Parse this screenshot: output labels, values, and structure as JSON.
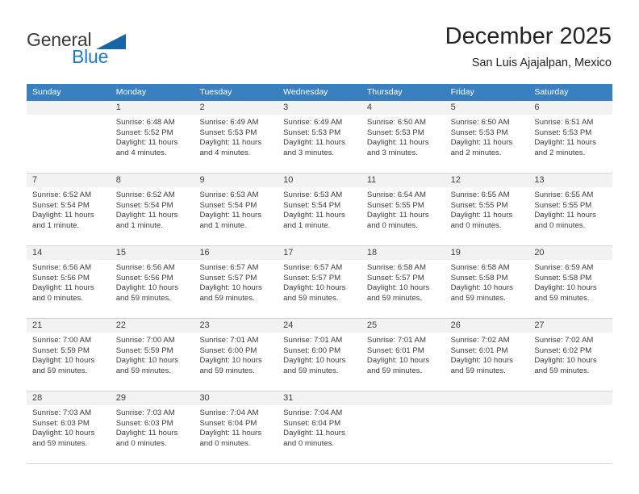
{
  "brand": {
    "name_part1": "General",
    "name_part2": "Blue",
    "accent_color": "#1f7bc1",
    "flag_color": "#1665a8"
  },
  "header": {
    "title": "December 2025",
    "subtitle": "San Luis Ajajalpan, Mexico"
  },
  "calendar": {
    "header_bg": "#3a80c1",
    "weekdays": [
      "Sunday",
      "Monday",
      "Tuesday",
      "Wednesday",
      "Thursday",
      "Friday",
      "Saturday"
    ],
    "weeks": [
      [
        {
          "day": "",
          "lines": []
        },
        {
          "day": "1",
          "lines": [
            "Sunrise: 6:48 AM",
            "Sunset: 5:52 PM",
            "Daylight: 11 hours",
            "and 4 minutes."
          ]
        },
        {
          "day": "2",
          "lines": [
            "Sunrise: 6:49 AM",
            "Sunset: 5:53 PM",
            "Daylight: 11 hours",
            "and 4 minutes."
          ]
        },
        {
          "day": "3",
          "lines": [
            "Sunrise: 6:49 AM",
            "Sunset: 5:53 PM",
            "Daylight: 11 hours",
            "and 3 minutes."
          ]
        },
        {
          "day": "4",
          "lines": [
            "Sunrise: 6:50 AM",
            "Sunset: 5:53 PM",
            "Daylight: 11 hours",
            "and 3 minutes."
          ]
        },
        {
          "day": "5",
          "lines": [
            "Sunrise: 6:50 AM",
            "Sunset: 5:53 PM",
            "Daylight: 11 hours",
            "and 2 minutes."
          ]
        },
        {
          "day": "6",
          "lines": [
            "Sunrise: 6:51 AM",
            "Sunset: 5:53 PM",
            "Daylight: 11 hours",
            "and 2 minutes."
          ]
        }
      ],
      [
        {
          "day": "7",
          "lines": [
            "Sunrise: 6:52 AM",
            "Sunset: 5:54 PM",
            "Daylight: 11 hours",
            "and 1 minute."
          ]
        },
        {
          "day": "8",
          "lines": [
            "Sunrise: 6:52 AM",
            "Sunset: 5:54 PM",
            "Daylight: 11 hours",
            "and 1 minute."
          ]
        },
        {
          "day": "9",
          "lines": [
            "Sunrise: 6:53 AM",
            "Sunset: 5:54 PM",
            "Daylight: 11 hours",
            "and 1 minute."
          ]
        },
        {
          "day": "10",
          "lines": [
            "Sunrise: 6:53 AM",
            "Sunset: 5:54 PM",
            "Daylight: 11 hours",
            "and 1 minute."
          ]
        },
        {
          "day": "11",
          "lines": [
            "Sunrise: 6:54 AM",
            "Sunset: 5:55 PM",
            "Daylight: 11 hours",
            "and 0 minutes."
          ]
        },
        {
          "day": "12",
          "lines": [
            "Sunrise: 6:55 AM",
            "Sunset: 5:55 PM",
            "Daylight: 11 hours",
            "and 0 minutes."
          ]
        },
        {
          "day": "13",
          "lines": [
            "Sunrise: 6:55 AM",
            "Sunset: 5:55 PM",
            "Daylight: 11 hours",
            "and 0 minutes."
          ]
        }
      ],
      [
        {
          "day": "14",
          "lines": [
            "Sunrise: 6:56 AM",
            "Sunset: 5:56 PM",
            "Daylight: 11 hours",
            "and 0 minutes."
          ]
        },
        {
          "day": "15",
          "lines": [
            "Sunrise: 6:56 AM",
            "Sunset: 5:56 PM",
            "Daylight: 10 hours",
            "and 59 minutes."
          ]
        },
        {
          "day": "16",
          "lines": [
            "Sunrise: 6:57 AM",
            "Sunset: 5:57 PM",
            "Daylight: 10 hours",
            "and 59 minutes."
          ]
        },
        {
          "day": "17",
          "lines": [
            "Sunrise: 6:57 AM",
            "Sunset: 5:57 PM",
            "Daylight: 10 hours",
            "and 59 minutes."
          ]
        },
        {
          "day": "18",
          "lines": [
            "Sunrise: 6:58 AM",
            "Sunset: 5:57 PM",
            "Daylight: 10 hours",
            "and 59 minutes."
          ]
        },
        {
          "day": "19",
          "lines": [
            "Sunrise: 6:58 AM",
            "Sunset: 5:58 PM",
            "Daylight: 10 hours",
            "and 59 minutes."
          ]
        },
        {
          "day": "20",
          "lines": [
            "Sunrise: 6:59 AM",
            "Sunset: 5:58 PM",
            "Daylight: 10 hours",
            "and 59 minutes."
          ]
        }
      ],
      [
        {
          "day": "21",
          "lines": [
            "Sunrise: 7:00 AM",
            "Sunset: 5:59 PM",
            "Daylight: 10 hours",
            "and 59 minutes."
          ]
        },
        {
          "day": "22",
          "lines": [
            "Sunrise: 7:00 AM",
            "Sunset: 5:59 PM",
            "Daylight: 10 hours",
            "and 59 minutes."
          ]
        },
        {
          "day": "23",
          "lines": [
            "Sunrise: 7:01 AM",
            "Sunset: 6:00 PM",
            "Daylight: 10 hours",
            "and 59 minutes."
          ]
        },
        {
          "day": "24",
          "lines": [
            "Sunrise: 7:01 AM",
            "Sunset: 6:00 PM",
            "Daylight: 10 hours",
            "and 59 minutes."
          ]
        },
        {
          "day": "25",
          "lines": [
            "Sunrise: 7:01 AM",
            "Sunset: 6:01 PM",
            "Daylight: 10 hours",
            "and 59 minutes."
          ]
        },
        {
          "day": "26",
          "lines": [
            "Sunrise: 7:02 AM",
            "Sunset: 6:01 PM",
            "Daylight: 10 hours",
            "and 59 minutes."
          ]
        },
        {
          "day": "27",
          "lines": [
            "Sunrise: 7:02 AM",
            "Sunset: 6:02 PM",
            "Daylight: 10 hours",
            "and 59 minutes."
          ]
        }
      ],
      [
        {
          "day": "28",
          "lines": [
            "Sunrise: 7:03 AM",
            "Sunset: 6:03 PM",
            "Daylight: 10 hours",
            "and 59 minutes."
          ]
        },
        {
          "day": "29",
          "lines": [
            "Sunrise: 7:03 AM",
            "Sunset: 6:03 PM",
            "Daylight: 11 hours",
            "and 0 minutes."
          ]
        },
        {
          "day": "30",
          "lines": [
            "Sunrise: 7:04 AM",
            "Sunset: 6:04 PM",
            "Daylight: 11 hours",
            "and 0 minutes."
          ]
        },
        {
          "day": "31",
          "lines": [
            "Sunrise: 7:04 AM",
            "Sunset: 6:04 PM",
            "Daylight: 11 hours",
            "and 0 minutes."
          ]
        },
        {
          "day": "",
          "lines": []
        },
        {
          "day": "",
          "lines": []
        },
        {
          "day": "",
          "lines": []
        }
      ]
    ]
  }
}
